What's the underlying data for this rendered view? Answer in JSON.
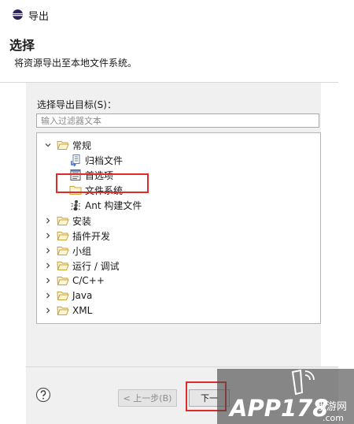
{
  "window": {
    "title": "导出"
  },
  "header": {
    "title": "选择",
    "subtitle": "将资源导出至本地文件系统。"
  },
  "content": {
    "targets_label": "选择导出目标(S)：",
    "filter_placeholder": "输入过滤器文本",
    "tree": [
      {
        "label": "常规",
        "expanded": true,
        "icon": "folder-open-icon"
      },
      {
        "label": "归档文件",
        "icon": "archive-file-icon"
      },
      {
        "label": "首选项",
        "icon": "preferences-icon"
      },
      {
        "label": "文件系统",
        "icon": "folder-icon"
      },
      {
        "label": "Ant 构建文件",
        "icon": "ant-icon"
      },
      {
        "label": "安装",
        "icon": "folder-icon"
      },
      {
        "label": "插件开发",
        "icon": "folder-icon"
      },
      {
        "label": "小组",
        "icon": "folder-icon"
      },
      {
        "label": "运行 / 调试",
        "icon": "folder-icon"
      },
      {
        "label": "C/C++",
        "icon": "folder-icon"
      },
      {
        "label": "Java",
        "icon": "folder-icon"
      },
      {
        "label": "XML",
        "icon": "folder-icon"
      }
    ]
  },
  "footer": {
    "back_label": "< 上一步(B)",
    "next_label": "下一"
  },
  "watermark": {
    "text": "APP178",
    "suffix": "手游网",
    "domain": ".com"
  },
  "colors": {
    "highlight": "#e02b2b",
    "panel": "#f0f0f0"
  }
}
